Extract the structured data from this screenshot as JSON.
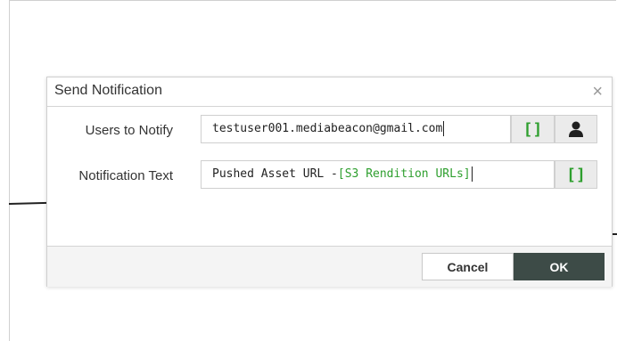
{
  "dialog": {
    "title": "Send Notification",
    "close_glyph": "×"
  },
  "users_field": {
    "label": "Users to Notify",
    "value": "testuser001.mediabeacon@gmail.com",
    "token_button_glyph": "[]",
    "token_icon": "bracket-insert-icon",
    "user_icon": "user-icon"
  },
  "text_field": {
    "label": "Notification Text",
    "value_plain": "Pushed Asset URL -",
    "value_token": "[S3 Rendition URLs]",
    "token_button_glyph": "[]",
    "token_icon": "bracket-insert-icon"
  },
  "footer": {
    "cancel_label": "Cancel",
    "ok_label": "OK"
  },
  "colors": {
    "token_green": "#2e9f2e",
    "ok_button_bg": "#3d4b47",
    "footer_bg": "#f4f4f4"
  }
}
